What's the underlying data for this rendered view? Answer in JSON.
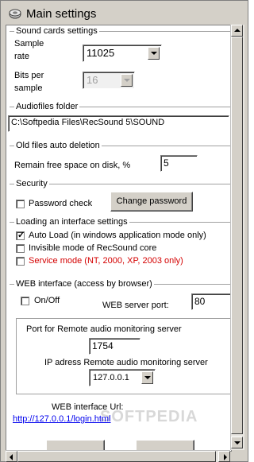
{
  "window": {
    "title": "Main settings",
    "icon": "app-icon"
  },
  "sound_cards": {
    "legend": "Sound cards settings",
    "sample_rate_label_1": "Sample",
    "sample_rate_label_2": "rate",
    "sample_rate_value": "11025",
    "bits_label_1": "Bits per",
    "bits_label_2": "sample",
    "bits_value": "16"
  },
  "audiofiles": {
    "legend": "Audiofiles folder",
    "path": "C:\\Softpedia Files\\RecSound 5\\SOUND"
  },
  "old_files": {
    "legend": "Old files auto deletion",
    "label": "Remain free space on disk, %",
    "value": "5"
  },
  "security": {
    "legend": "Security",
    "password_check_label": "Password check",
    "password_check_checked": false,
    "change_password_label": "Change password"
  },
  "interface": {
    "legend": "Loading an interface settings",
    "options": [
      {
        "label": "Auto Load (in windows application mode only)",
        "checked": true,
        "color": "#000000"
      },
      {
        "label": "Invisible mode of RecSound core",
        "checked": false,
        "color": "#000000"
      },
      {
        "label": "Service mode (NT, 2000, XP, 2003 only)",
        "checked": false,
        "color": "#d40000"
      }
    ]
  },
  "web": {
    "legend": "WEB interface (access by  browser)",
    "onoff_label": "On/Off",
    "onoff_checked": false,
    "server_port_label": "WEB server port:",
    "server_port_value": "80",
    "remote_port_label": "Port for Remote audio monitoring server",
    "remote_port_value": "1754",
    "ip_label": "IP adress Remote audio monitoring server",
    "ip_value": "127.0.0.1",
    "url_label": "WEB interface Url:",
    "url_value": "http://127.0.0.1/login.html"
  },
  "watermark": "SOFTPEDIA"
}
